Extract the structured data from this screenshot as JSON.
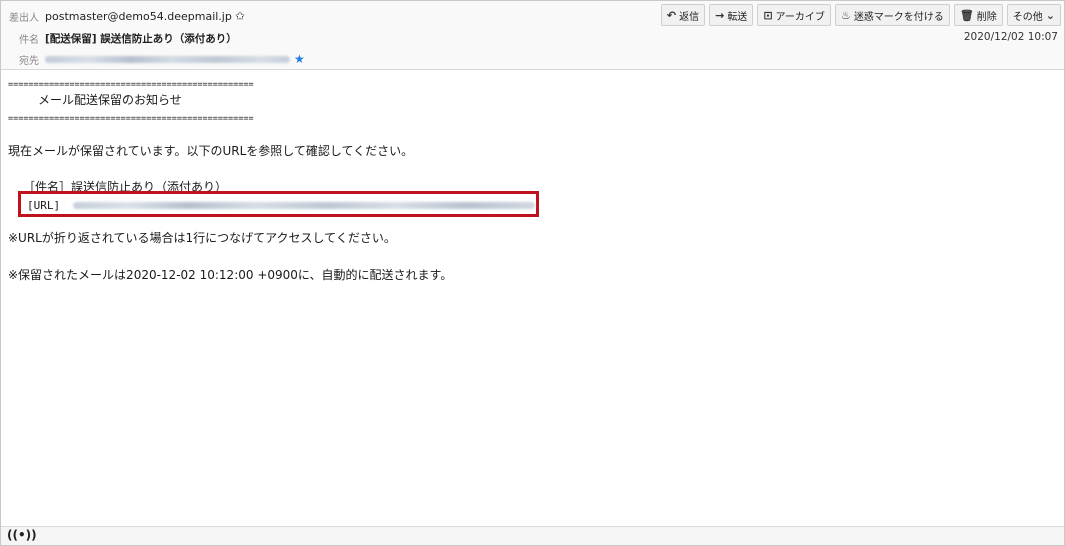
{
  "header": {
    "from_label": "差出人",
    "from_address": "postmaster@demo54.deepmail.jp",
    "subject_label": "件名",
    "subject": "[配送保留] 誤送信防止あり（添付あり）",
    "to_label": "宛先",
    "date": "2020/12/02 10:07"
  },
  "toolbar": {
    "reply": "返信",
    "forward": "転送",
    "archive": "アーカイブ",
    "junk": "迷惑マークを付ける",
    "delete": "削除",
    "more": "その他"
  },
  "message": {
    "rule_line": "================================================",
    "title": "メール配送保留のお知らせ",
    "intro": "現在メールが保留されています。以下のURLを参照して確認してください。",
    "subject_line": "［件名］誤送信防止あり（添付あり）",
    "url_label": "[URL]",
    "note_wrap": "※URLが折り返されている場合は1行につなげてアクセスしてください。",
    "note_delivery": "※保留されたメールは2020-12-02 10:12:00 +0900に、自動的に配送されます。"
  }
}
